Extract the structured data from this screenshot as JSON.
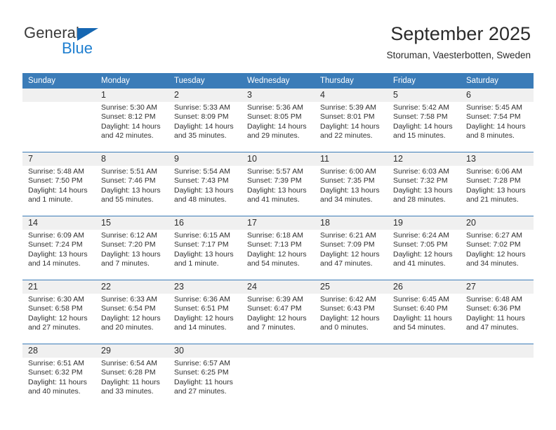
{
  "logo": {
    "word_one": "General",
    "word_two": "Blue",
    "triangle_color": "#1667b2",
    "blue_text_color": "#1f7fd0"
  },
  "header": {
    "title": "September 2025",
    "subtitle": "Storuman, Vaesterbotten, Sweden"
  },
  "theme": {
    "header_blue": "#3b7cb8",
    "daynum_band": "#f0f0f0",
    "text": "#303030"
  },
  "weekdays": [
    "Sunday",
    "Monday",
    "Tuesday",
    "Wednesday",
    "Thursday",
    "Friday",
    "Saturday"
  ],
  "weeks": [
    {
      "days": [
        {
          "num": "",
          "lines": [
            "",
            "",
            "",
            ""
          ]
        },
        {
          "num": "1",
          "lines": [
            "Sunrise: 5:30 AM",
            "Sunset: 8:12 PM",
            "Daylight: 14 hours",
            "and 42 minutes."
          ]
        },
        {
          "num": "2",
          "lines": [
            "Sunrise: 5:33 AM",
            "Sunset: 8:09 PM",
            "Daylight: 14 hours",
            "and 35 minutes."
          ]
        },
        {
          "num": "3",
          "lines": [
            "Sunrise: 5:36 AM",
            "Sunset: 8:05 PM",
            "Daylight: 14 hours",
            "and 29 minutes."
          ]
        },
        {
          "num": "4",
          "lines": [
            "Sunrise: 5:39 AM",
            "Sunset: 8:01 PM",
            "Daylight: 14 hours",
            "and 22 minutes."
          ]
        },
        {
          "num": "5",
          "lines": [
            "Sunrise: 5:42 AM",
            "Sunset: 7:58 PM",
            "Daylight: 14 hours",
            "and 15 minutes."
          ]
        },
        {
          "num": "6",
          "lines": [
            "Sunrise: 5:45 AM",
            "Sunset: 7:54 PM",
            "Daylight: 14 hours",
            "and 8 minutes."
          ]
        }
      ]
    },
    {
      "days": [
        {
          "num": "7",
          "lines": [
            "Sunrise: 5:48 AM",
            "Sunset: 7:50 PM",
            "Daylight: 14 hours",
            "and 1 minute."
          ]
        },
        {
          "num": "8",
          "lines": [
            "Sunrise: 5:51 AM",
            "Sunset: 7:46 PM",
            "Daylight: 13 hours",
            "and 55 minutes."
          ]
        },
        {
          "num": "9",
          "lines": [
            "Sunrise: 5:54 AM",
            "Sunset: 7:43 PM",
            "Daylight: 13 hours",
            "and 48 minutes."
          ]
        },
        {
          "num": "10",
          "lines": [
            "Sunrise: 5:57 AM",
            "Sunset: 7:39 PM",
            "Daylight: 13 hours",
            "and 41 minutes."
          ]
        },
        {
          "num": "11",
          "lines": [
            "Sunrise: 6:00 AM",
            "Sunset: 7:35 PM",
            "Daylight: 13 hours",
            "and 34 minutes."
          ]
        },
        {
          "num": "12",
          "lines": [
            "Sunrise: 6:03 AM",
            "Sunset: 7:32 PM",
            "Daylight: 13 hours",
            "and 28 minutes."
          ]
        },
        {
          "num": "13",
          "lines": [
            "Sunrise: 6:06 AM",
            "Sunset: 7:28 PM",
            "Daylight: 13 hours",
            "and 21 minutes."
          ]
        }
      ]
    },
    {
      "days": [
        {
          "num": "14",
          "lines": [
            "Sunrise: 6:09 AM",
            "Sunset: 7:24 PM",
            "Daylight: 13 hours",
            "and 14 minutes."
          ]
        },
        {
          "num": "15",
          "lines": [
            "Sunrise: 6:12 AM",
            "Sunset: 7:20 PM",
            "Daylight: 13 hours",
            "and 7 minutes."
          ]
        },
        {
          "num": "16",
          "lines": [
            "Sunrise: 6:15 AM",
            "Sunset: 7:17 PM",
            "Daylight: 13 hours",
            "and 1 minute."
          ]
        },
        {
          "num": "17",
          "lines": [
            "Sunrise: 6:18 AM",
            "Sunset: 7:13 PM",
            "Daylight: 12 hours",
            "and 54 minutes."
          ]
        },
        {
          "num": "18",
          "lines": [
            "Sunrise: 6:21 AM",
            "Sunset: 7:09 PM",
            "Daylight: 12 hours",
            "and 47 minutes."
          ]
        },
        {
          "num": "19",
          "lines": [
            "Sunrise: 6:24 AM",
            "Sunset: 7:05 PM",
            "Daylight: 12 hours",
            "and 41 minutes."
          ]
        },
        {
          "num": "20",
          "lines": [
            "Sunrise: 6:27 AM",
            "Sunset: 7:02 PM",
            "Daylight: 12 hours",
            "and 34 minutes."
          ]
        }
      ]
    },
    {
      "days": [
        {
          "num": "21",
          "lines": [
            "Sunrise: 6:30 AM",
            "Sunset: 6:58 PM",
            "Daylight: 12 hours",
            "and 27 minutes."
          ]
        },
        {
          "num": "22",
          "lines": [
            "Sunrise: 6:33 AM",
            "Sunset: 6:54 PM",
            "Daylight: 12 hours",
            "and 20 minutes."
          ]
        },
        {
          "num": "23",
          "lines": [
            "Sunrise: 6:36 AM",
            "Sunset: 6:51 PM",
            "Daylight: 12 hours",
            "and 14 minutes."
          ]
        },
        {
          "num": "24",
          "lines": [
            "Sunrise: 6:39 AM",
            "Sunset: 6:47 PM",
            "Daylight: 12 hours",
            "and 7 minutes."
          ]
        },
        {
          "num": "25",
          "lines": [
            "Sunrise: 6:42 AM",
            "Sunset: 6:43 PM",
            "Daylight: 12 hours",
            "and 0 minutes."
          ]
        },
        {
          "num": "26",
          "lines": [
            "Sunrise: 6:45 AM",
            "Sunset: 6:40 PM",
            "Daylight: 11 hours",
            "and 54 minutes."
          ]
        },
        {
          "num": "27",
          "lines": [
            "Sunrise: 6:48 AM",
            "Sunset: 6:36 PM",
            "Daylight: 11 hours",
            "and 47 minutes."
          ]
        }
      ]
    },
    {
      "days": [
        {
          "num": "28",
          "lines": [
            "Sunrise: 6:51 AM",
            "Sunset: 6:32 PM",
            "Daylight: 11 hours",
            "and 40 minutes."
          ]
        },
        {
          "num": "29",
          "lines": [
            "Sunrise: 6:54 AM",
            "Sunset: 6:28 PM",
            "Daylight: 11 hours",
            "and 33 minutes."
          ]
        },
        {
          "num": "30",
          "lines": [
            "Sunrise: 6:57 AM",
            "Sunset: 6:25 PM",
            "Daylight: 11 hours",
            "and 27 minutes."
          ]
        },
        {
          "num": "",
          "lines": [
            "",
            "",
            "",
            ""
          ]
        },
        {
          "num": "",
          "lines": [
            "",
            "",
            "",
            ""
          ]
        },
        {
          "num": "",
          "lines": [
            "",
            "",
            "",
            ""
          ]
        },
        {
          "num": "",
          "lines": [
            "",
            "",
            "",
            ""
          ]
        }
      ]
    }
  ]
}
